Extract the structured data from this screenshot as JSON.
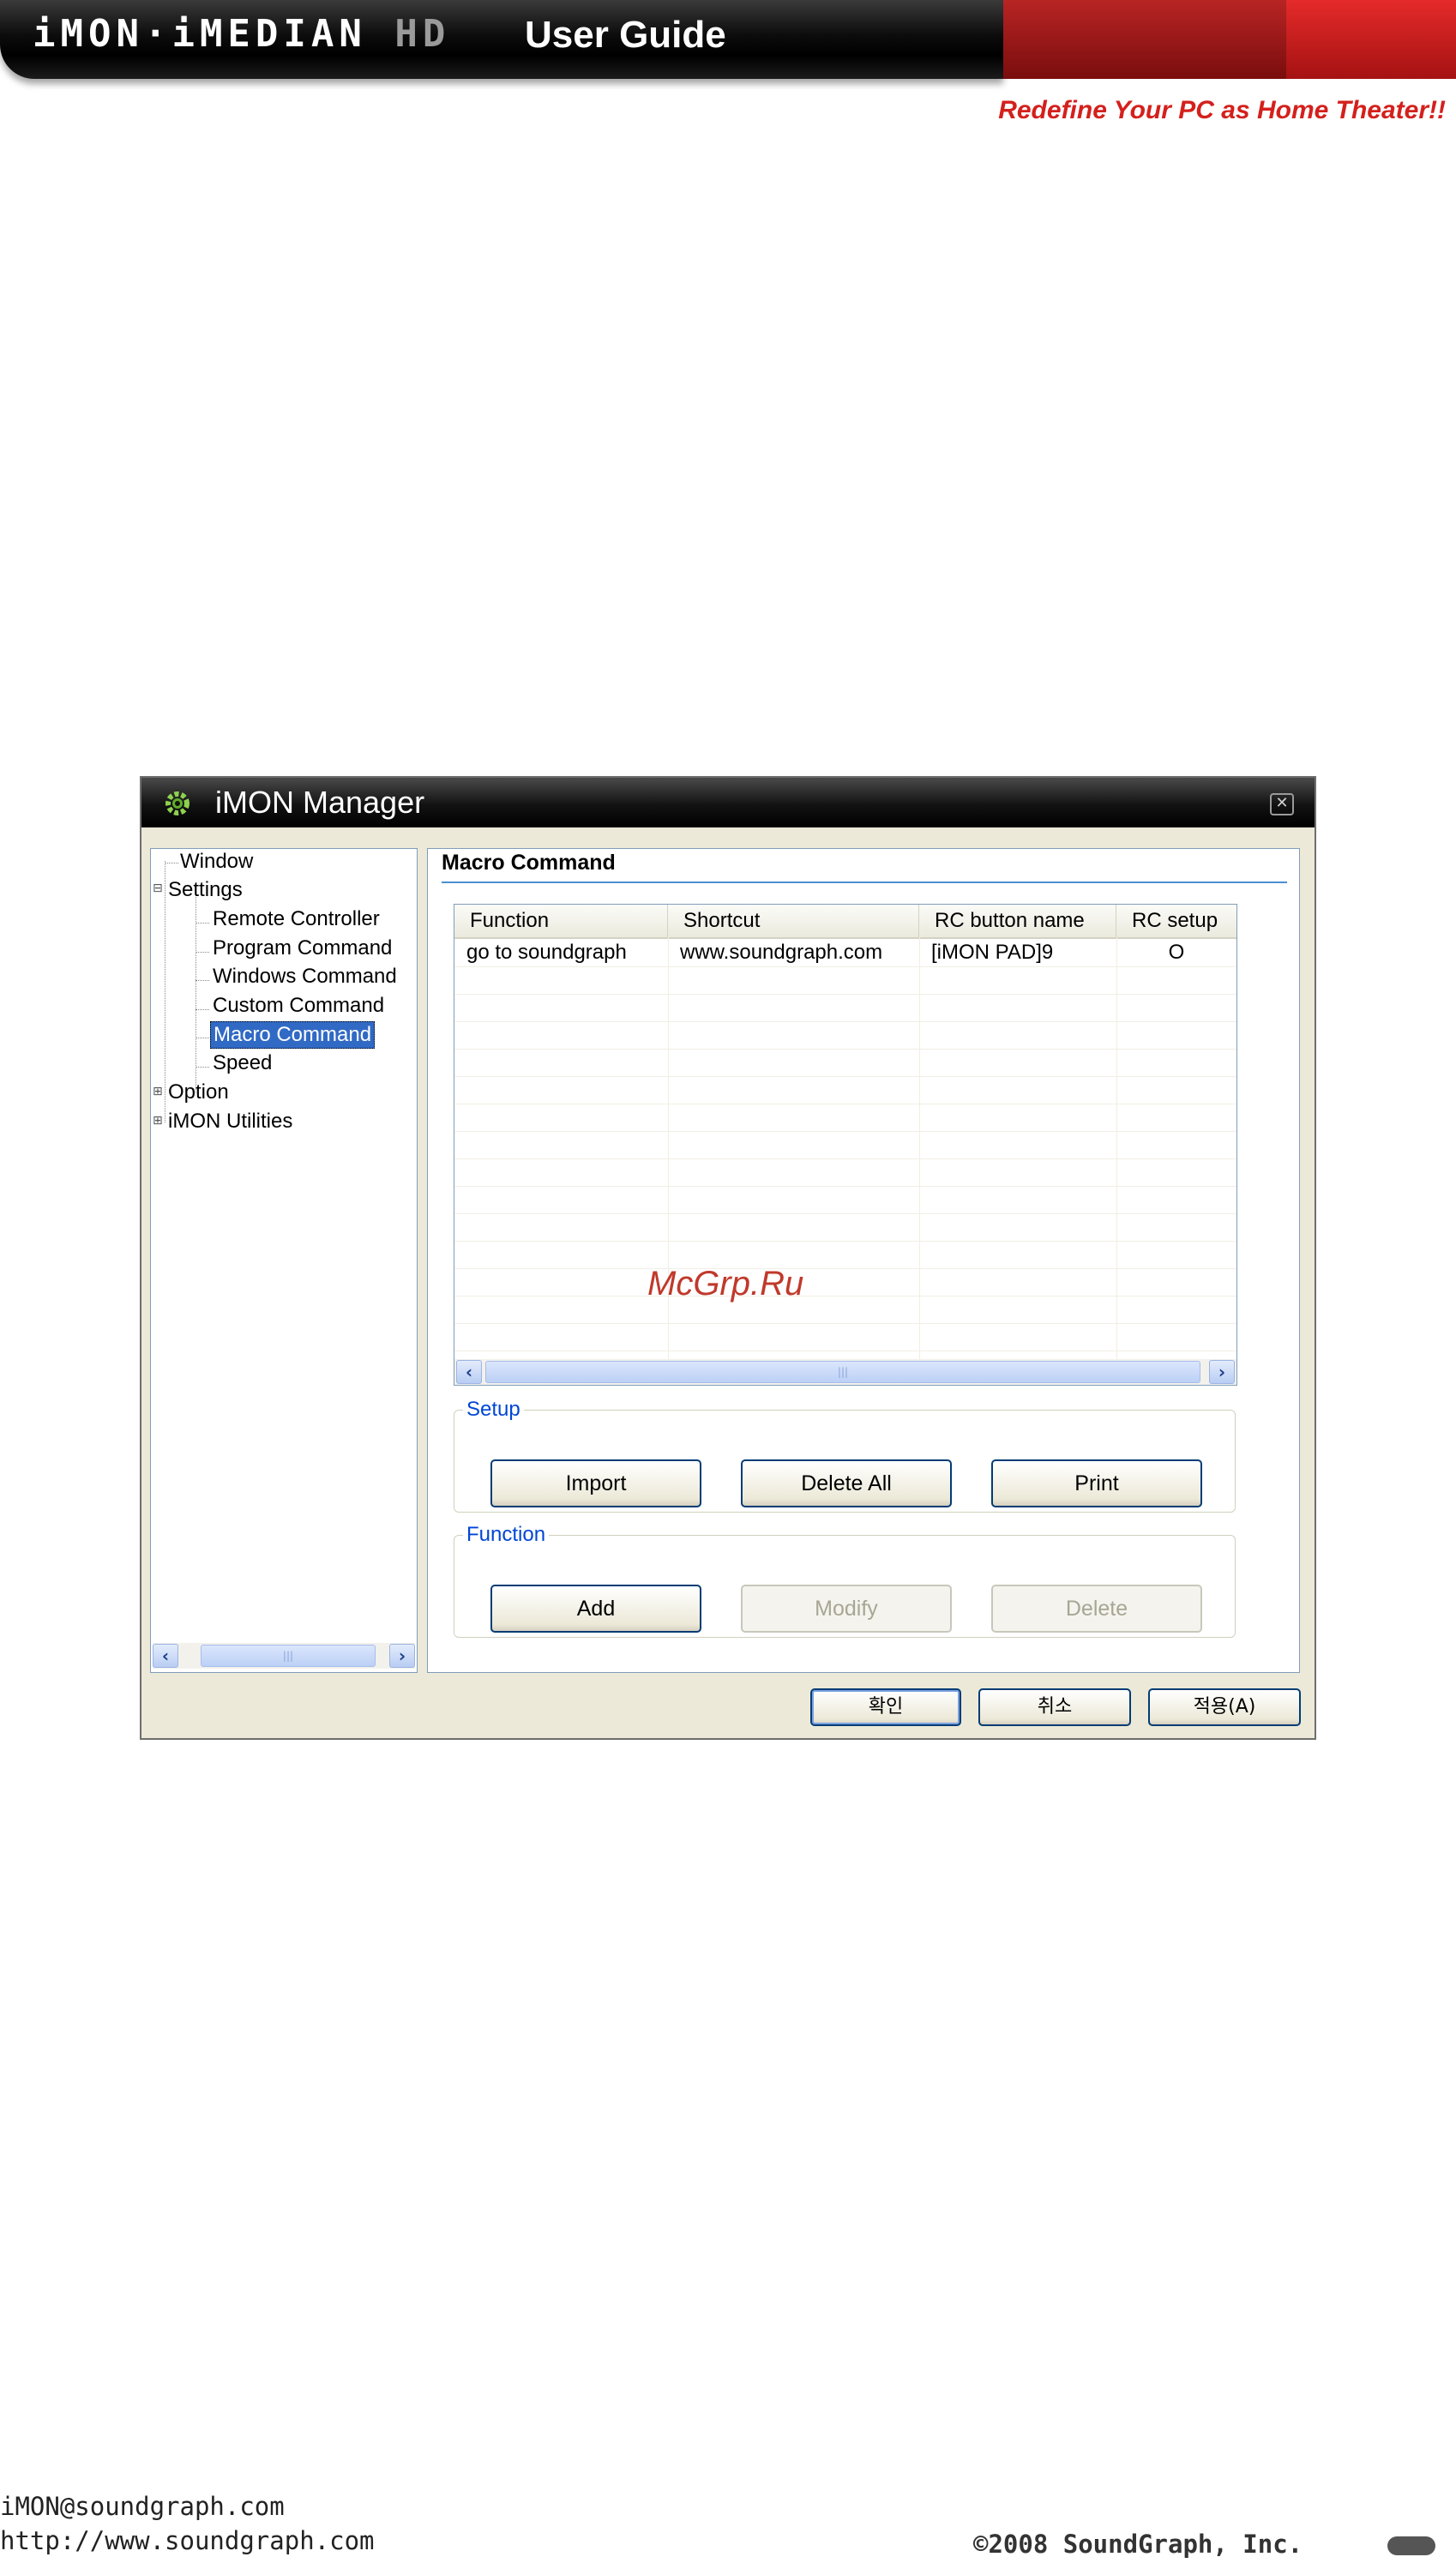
{
  "header": {
    "brand": "iMON·iMEDIAN",
    "brand_hd": "HD",
    "title": "User Guide",
    "tagline": "Redefine Your PC as Home Theater!!"
  },
  "window": {
    "title": "iMON Manager",
    "tree": [
      "Window",
      "Settings",
      "Remote Controller",
      "Program Command",
      "Windows Command",
      "Custom Command",
      "Macro Command",
      "Speed",
      "Option",
      "iMON Utilities"
    ],
    "section_title": "Macro Command",
    "table": {
      "columns": [
        "Function",
        "Shortcut",
        "RC button name",
        "RC setup"
      ],
      "rows": [
        [
          "go to soundgraph",
          "www.soundgraph.com",
          "[iMON PAD]9",
          "O"
        ]
      ]
    },
    "setup_group": {
      "legend": "Setup",
      "buttons": [
        "Import",
        "Delete All",
        "Print"
      ]
    },
    "function_group": {
      "legend": "Function",
      "buttons": [
        "Add",
        "Modify",
        "Delete"
      ]
    },
    "footer_buttons": [
      "확인",
      "취소",
      "적용(A)"
    ]
  },
  "watermark": "McGrp.Ru",
  "footer": {
    "email": "iMON@soundgraph.com",
    "website": "http://www.soundgraph.com",
    "copyright": "2008 SoundGraph, Inc."
  },
  "colors": {
    "accent_red": "#d4201c",
    "selection_blue": "#316ac5",
    "legend_blue": "#0046d5"
  }
}
